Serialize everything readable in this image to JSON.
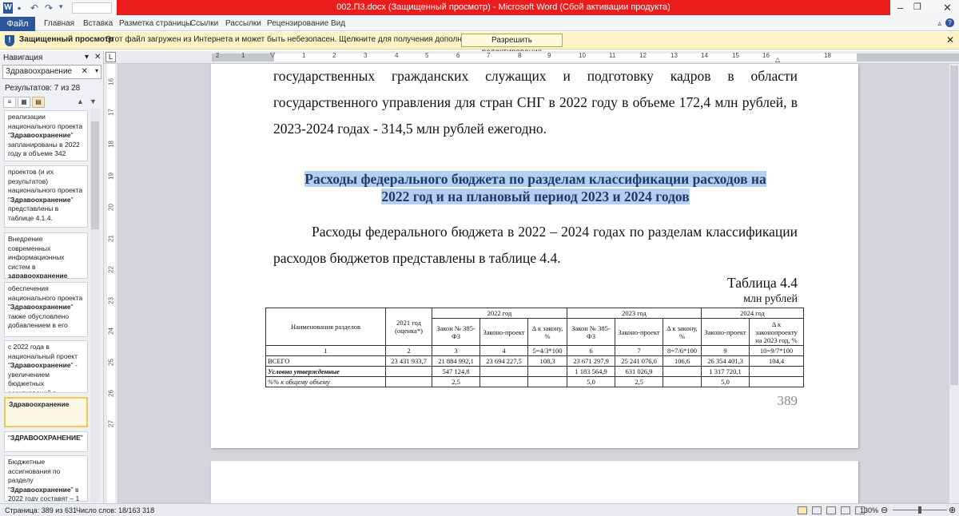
{
  "window": {
    "title": "002.П3.docx (Защищенный просмотр) - Microsoft Word (Сбой активации продукта)",
    "app_icon": "word-icon",
    "qa_undo": "↶",
    "qa_redo": "↷"
  },
  "ribbon": {
    "file_label": "Файл",
    "tabs": [
      "Главная",
      "Вставка",
      "Разметка страницы",
      "Ссылки",
      "Рассылки",
      "Рецензирование",
      "Вид"
    ]
  },
  "protected": {
    "title": "Защищенный просмотр",
    "message": "Этот файл загружен из Интернета и может быть небезопасен. Щелкните для получения дополнительных сведений.",
    "button": "Разрешить редактирование"
  },
  "nav": {
    "header": "Навигация",
    "search_value": "Здравоохранение",
    "results": "Результатов: 7 из 28",
    "cards": [
      {
        "a": "реализации национального проекта \"",
        "b": "Здравоохранение",
        "c": "\" запланированы в 2022 году в объеме 342"
      },
      {
        "a": "проектов (и их результатов) национального проекта \"",
        "b": "Здравоохранение",
        "c": "\" представлены в таблице 4.1.4."
      },
      {
        "a": "Внедрение современных информационных систем в ",
        "b": "здравоохранение",
        "c": ""
      },
      {
        "a": "обеспечения национального проекта \"",
        "b": "Здравоохранение",
        "c": "\" также обусловлено добавлением в его"
      },
      {
        "a": "с 2022 года в национальный проект \"",
        "b": "Здравоохранение",
        "c": "\" - увеличением бюджетных ассигнований в"
      },
      {
        "a": "",
        "b": "Здравоохранение",
        "c": ""
      },
      {
        "a": "\"",
        "b": "ЗДРАВООХРАНЕНИЕ",
        "c": "\""
      },
      {
        "a": "Бюджетные ассигнования по разделу \"",
        "b": "Здравоохранение",
        "c": "\" в 2022 году составят – 1"
      }
    ]
  },
  "ruler": {
    "h_numbers": [
      "2",
      "1",
      "1",
      "2",
      "3",
      "4",
      "5",
      "6",
      "7",
      "8",
      "9",
      "10",
      "11",
      "12",
      "13",
      "14",
      "15",
      "16",
      "18"
    ],
    "v_numbers": [
      "16",
      "17",
      "18",
      "19",
      "20",
      "21",
      "22",
      "23",
      "24",
      "25",
      "26",
      "27"
    ]
  },
  "document": {
    "para1": "государственных гражданских служащих и подготовку кадров в области государственного управления для стран СНГ в 2022 году в объеме 172,4 млн рублей, в 2023-2024 годах - 314,5 млн рублей ежегодно.",
    "heading_line1": "Расходы федерального бюджета по разделам классификации расходов на",
    "heading_line2": "2022 год и на плановый период 2023 и 2024 годов",
    "para2": "Расходы федерального бюджета в 2022 – 2024 годах по разделам классификации расходов бюджетов представлены в таблице 4.4.",
    "table_caption": "Таблица 4.4",
    "table_unit": "млн рублей",
    "page_number": "389",
    "table": {
      "h_name": "Наименования разделов",
      "h_2021": "2021 год (оценка*)",
      "h_2022": "2022 год",
      "h_2023": "2023 год",
      "h_2024": "2024 год",
      "sub": [
        "Закон № 385-ФЗ",
        "Законо-проект",
        "Δ к закону, %",
        "Закон № 385-ФЗ",
        "Законо-проект",
        "Δ к закону, %",
        "Законо-проект",
        "Δ к законопроекту на 2023 год, %"
      ],
      "idx": [
        "1",
        "2",
        "3",
        "4",
        "5=4/3*100",
        "6",
        "7",
        "8=7/6*100",
        "9",
        "10=9/7*100"
      ],
      "rows": [
        [
          "ВСЕГО",
          "23 431 933,7",
          "21 884 992,1",
          "23 694 227,5",
          "108,3",
          "23 671 297,9",
          "25 241 076,0",
          "106,6",
          "26 354 401,3",
          "104,4"
        ],
        [
          "Условно утвержденные",
          "",
          "547 124,8",
          "",
          "",
          "1 183 564,9",
          "631 026,9",
          "",
          "1 317 720,1",
          ""
        ],
        [
          "%% к общему объему",
          "",
          "2,5",
          "",
          "",
          "5,0",
          "2,5",
          "",
          "5,0",
          ""
        ]
      ]
    }
  },
  "status": {
    "page": "Страница: 389 из 631",
    "words": "Число слов: 18/163 318",
    "zoom": "130%"
  }
}
